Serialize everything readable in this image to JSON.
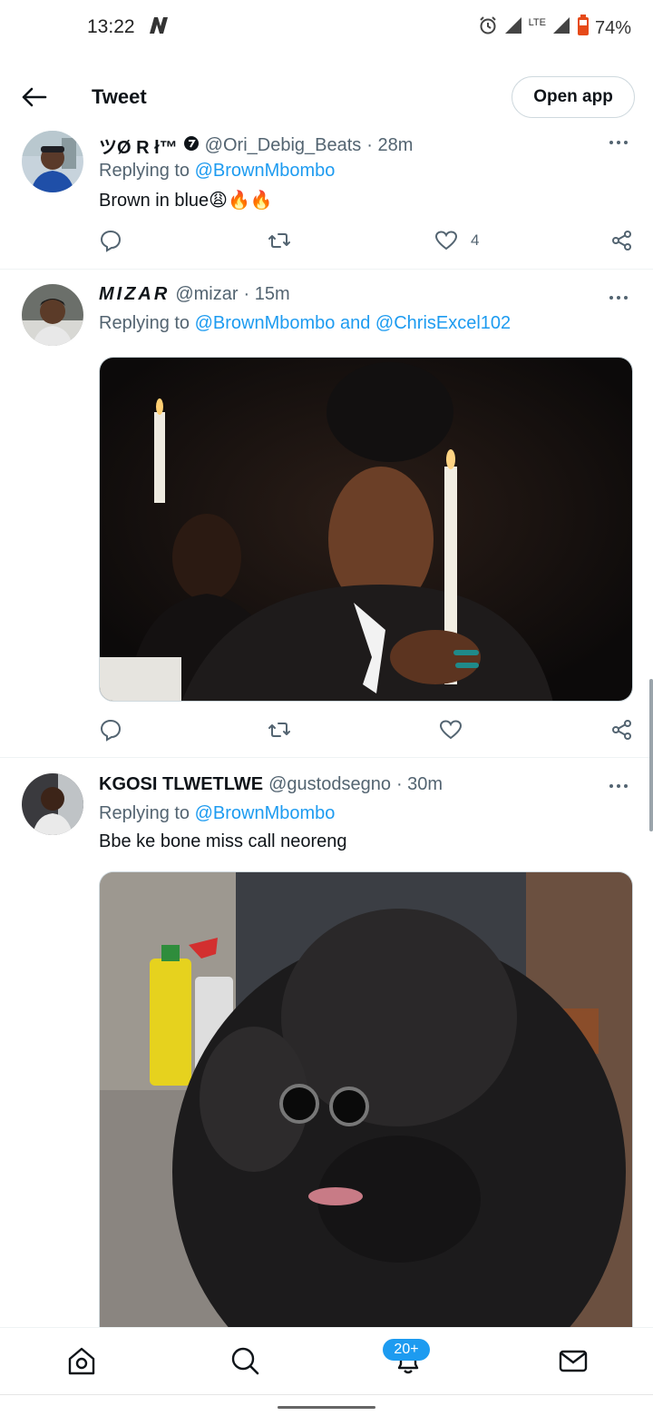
{
  "status_bar": {
    "time": "13:22",
    "network_logo": "N",
    "lte": "LTE",
    "battery": "74%"
  },
  "header": {
    "title": "Tweet",
    "open_app_label": "Open app",
    "back_icon": "arrow-left-icon"
  },
  "tweets": [
    {
      "name": "ツØ R ł™",
      "handle": "@Ori_Debig_Beats",
      "time": "· 28m",
      "replying_prefix": "Replying to",
      "mentions": "@BrownMbombo",
      "text": "Brown in blue😩🔥🔥",
      "like_count": "4"
    },
    {
      "name": "MIZAR",
      "handle": "@mizar",
      "time": "· 15m",
      "replying_prefix": "Replying to",
      "mentions": "@BrownMbombo and @ChrisExcel102",
      "text": ""
    },
    {
      "name": "KGOSI TLWETLWE",
      "handle": "@gustodsegno",
      "time": "· 30m",
      "replying_prefix": "Replying to",
      "mentions": "@BrownMbombo",
      "text": "Bbe ke bone miss call neoreng"
    }
  ],
  "bottom_nav": {
    "items": [
      "home-icon",
      "search-icon",
      "notifications-icon",
      "messages-icon"
    ],
    "notification_badge": "20+"
  },
  "colors": {
    "accent": "#1d9bf0",
    "text_primary": "#0f1419",
    "text_secondary": "#536471",
    "divider": "#eff3f4"
  }
}
